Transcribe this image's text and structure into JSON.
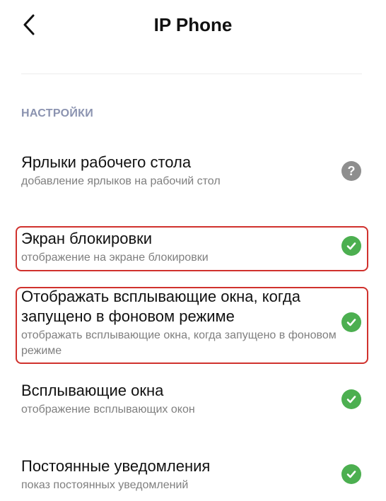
{
  "header": {
    "title": "IP Phone",
    "back_icon": "chevron-left-icon"
  },
  "section": {
    "label": "НАСТРОЙКИ"
  },
  "items": [
    {
      "title": "Ярлыки рабочего стола",
      "subtitle": "добавление ярлыков на рабочий стол",
      "status": "help",
      "status_icon": "question-icon",
      "status_glyph": "?",
      "highlighted": false
    },
    {
      "title": "Экран блокировки",
      "subtitle": "отображение на экране блокировки",
      "status": "enabled",
      "status_icon": "check-icon",
      "highlighted": true
    },
    {
      "title": "Отображать всплывающие окна, когда запущено в фоновом режиме",
      "subtitle": "отображать всплывающие окна, когда запущено в фоновом режиме",
      "status": "enabled",
      "status_icon": "check-icon",
      "highlighted": true
    },
    {
      "title": "Всплывающие окна",
      "subtitle": "отображение всплывающих окон",
      "status": "enabled",
      "status_icon": "check-icon",
      "highlighted": false
    },
    {
      "title": "Постоянные уведомления",
      "subtitle": "показ постоянных уведомлений",
      "status": "enabled",
      "status_icon": "check-icon",
      "highlighted": false
    }
  ],
  "colors": {
    "accent_green": "#4caf50",
    "help_gray": "#8e8e8e",
    "highlight_red": "#d0312d",
    "section_label": "#8b93b0"
  }
}
